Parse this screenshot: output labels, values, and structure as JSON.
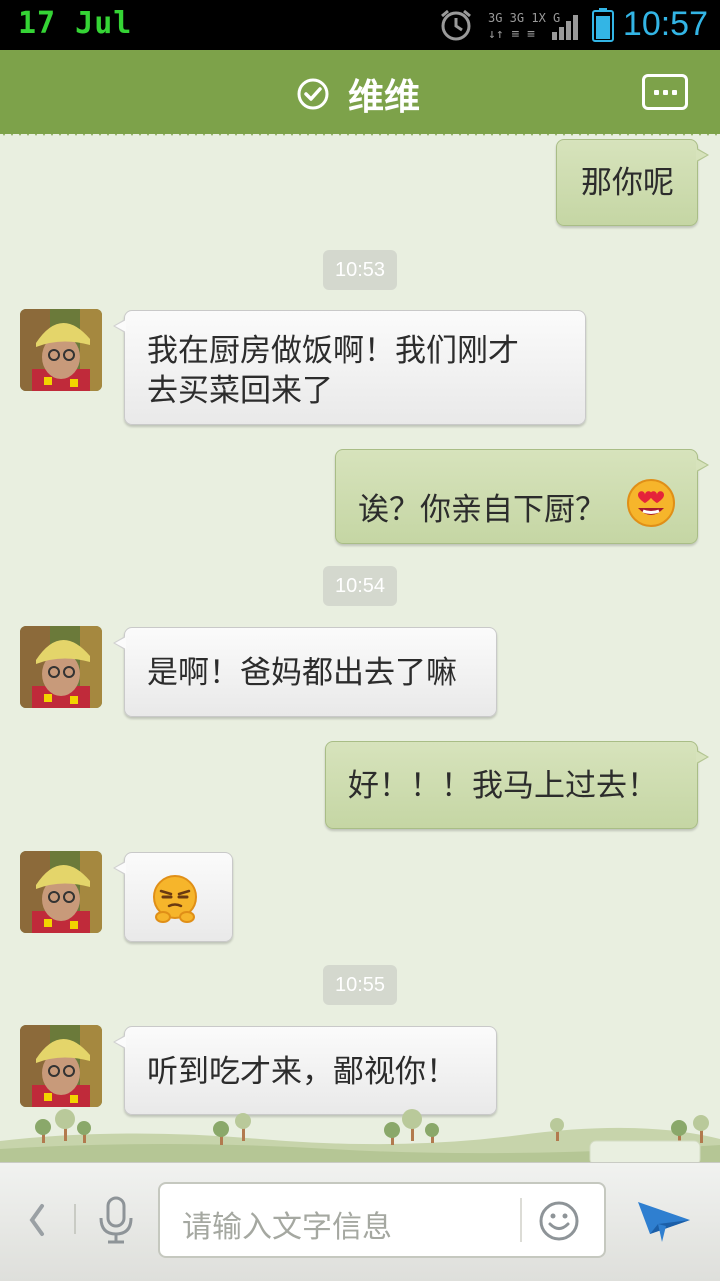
{
  "status_bar": {
    "date": "17 Jul",
    "time": "10:57",
    "network": "3G 3G 1X G"
  },
  "header": {
    "title": "维维",
    "verified_icon": "check-circle-icon",
    "menu_icon": "more-dots-icon"
  },
  "messages": [
    {
      "type": "out",
      "text": "那你呢"
    },
    {
      "type": "time",
      "text": "10:53"
    },
    {
      "type": "in",
      "line1": "我在厨房做饭啊！我们刚才",
      "line2": "去买菜回来了"
    },
    {
      "type": "out",
      "text": "诶？你亲自下厨？",
      "emoji": "heart-eyes-emoji"
    },
    {
      "type": "time",
      "text": "10:54"
    },
    {
      "type": "in",
      "text": "是啊！爸妈都出去了嘛"
    },
    {
      "type": "out",
      "text": "好！！！我马上过去！"
    },
    {
      "type": "in",
      "emoji": "smug-emoji"
    },
    {
      "type": "time",
      "text": "10:55"
    },
    {
      "type": "in",
      "text": "听到吃才来，鄙视你！"
    }
  ],
  "input_bar": {
    "placeholder": "请输入文字信息",
    "back_icon": "chevron-left-icon",
    "voice_icon": "microphone-icon",
    "emoji_icon": "smiley-icon",
    "send_icon": "send-plane-icon"
  },
  "colors": {
    "header": "#7da24a",
    "chat_bg": "#e9efe0",
    "out_bubble": "#c9d9a9",
    "in_bubble": "#f4f4f4",
    "clock": "#33b5e5",
    "date": "#35d435"
  }
}
